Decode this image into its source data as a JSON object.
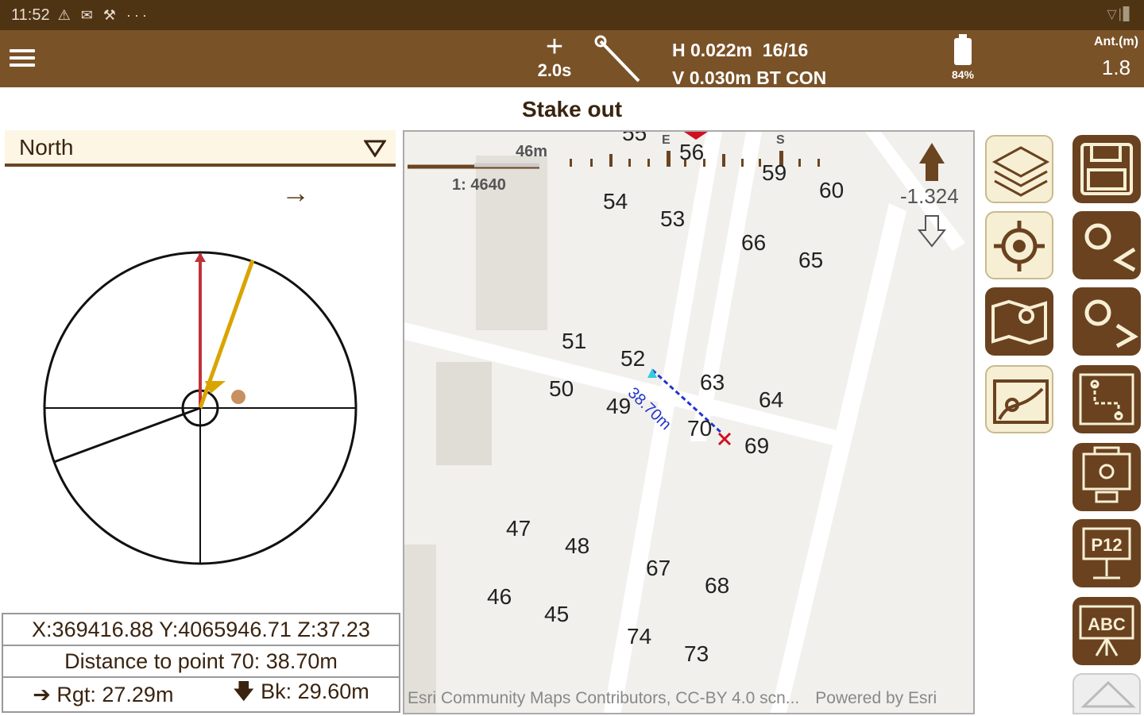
{
  "statusbar": {
    "time": "11:52",
    "icons": "⚠ ✉ ⚒  ···",
    "right": "▽∣▋"
  },
  "toolbar": {
    "interval": "2.0s",
    "precision_h": "H 0.022m  16/16",
    "precision_v": "V 0.030m BT CON",
    "battery": "84%",
    "ant_label": "Ant.(m)",
    "ant_value": "1.8"
  },
  "title": "Stake out",
  "orientation": {
    "selected": "North"
  },
  "info": {
    "coords": "X:369416.88   Y:4065946.71   Z:37.23",
    "distance": "Distance to point 70: 38.70m",
    "right": "Rgt: 27.29m",
    "back": "Bk: 29.60m"
  },
  "map": {
    "scale_dist": "46m",
    "scale_ratio": "1: 4640",
    "elevation_diff": "-1.324",
    "distance_label": "38.70m",
    "compass_letters": [
      "E",
      "S"
    ],
    "attribution": "Esri Community Maps Contributors, CC-BY 4.0 scn...",
    "powered": "Powered by Esri",
    "points": [
      "56",
      "59",
      "60",
      "54",
      "53",
      "66",
      "65",
      "51",
      "52",
      "63",
      "64",
      "50",
      "49",
      "70",
      "69",
      "47",
      "48",
      "67",
      "68",
      "46",
      "45",
      "74",
      "73",
      "55"
    ]
  },
  "colors": {
    "brown_dark": "#4f3414",
    "brown": "#7a5228",
    "button_dark": "#6a4220",
    "button_light": "#f7efd3"
  },
  "side_buttons": [
    "layers-icon",
    "locate-icon",
    "map-icon",
    "map-pin-icon",
    "save-icon",
    "previous-point-icon",
    "next-point-icon",
    "stakeout-plan-icon",
    "total-station-icon",
    "p12-icon",
    "abc-label-icon",
    "home-icon"
  ]
}
